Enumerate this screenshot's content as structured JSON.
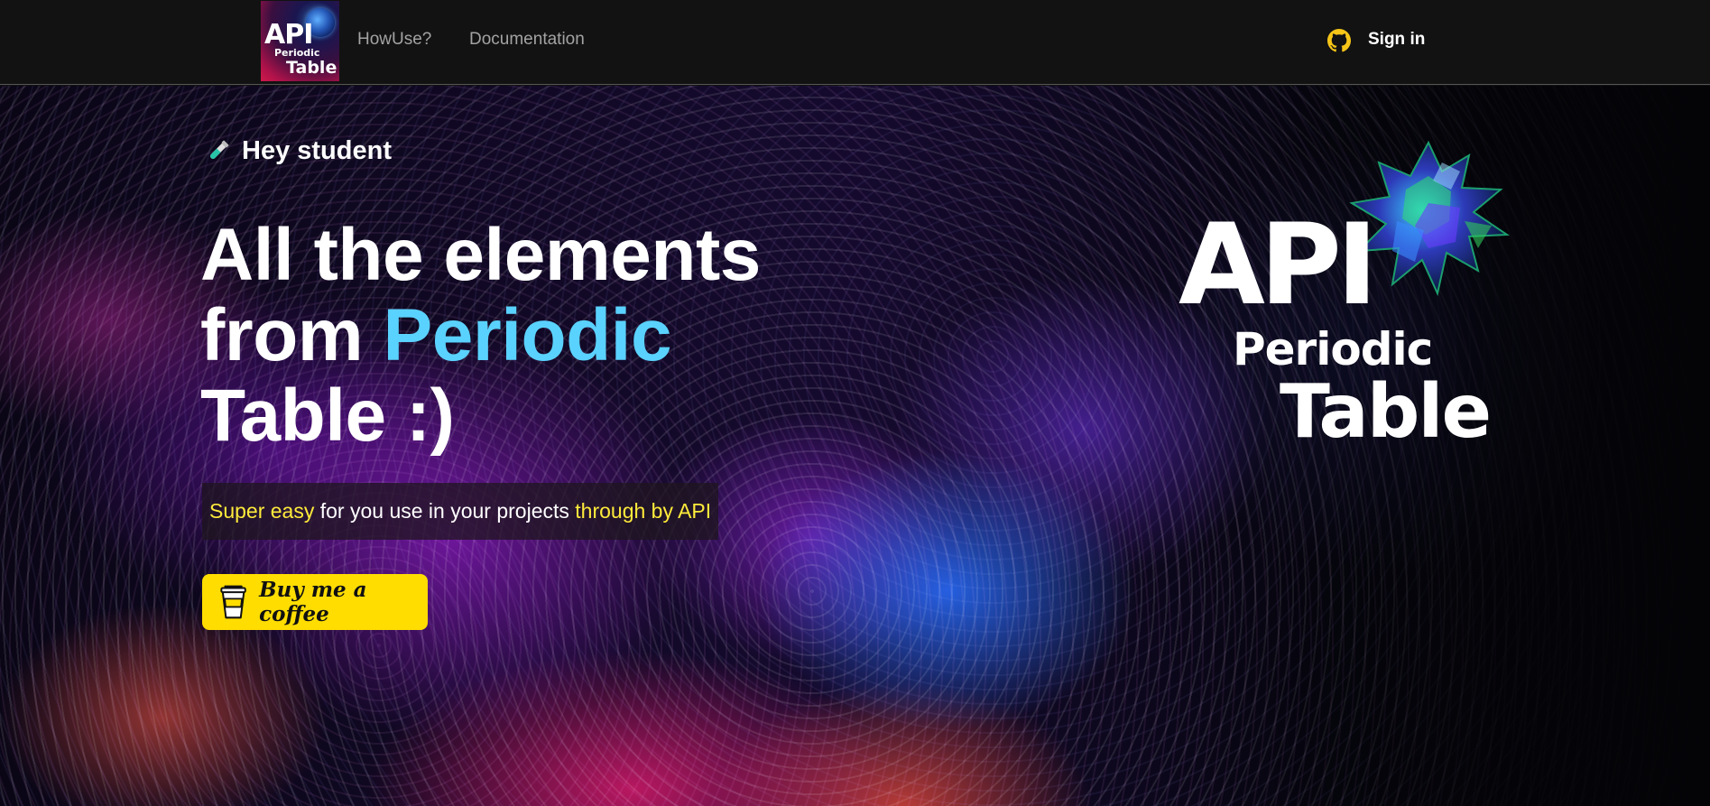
{
  "nav": {
    "logo": {
      "line1": "API",
      "line2": "Periodic",
      "line3": "Table"
    },
    "links": [
      {
        "label": "HowUse?"
      },
      {
        "label": "Documentation"
      }
    ],
    "sign_in": "Sign in",
    "github_icon": "github-icon"
  },
  "hero": {
    "greeting": "Hey student",
    "greeting_icon": "test-tube-icon",
    "headline": {
      "part1": "All the elements",
      "part2": "from",
      "accent": "Periodic",
      "part3": "Table :)"
    },
    "tagline": {
      "highlight1": "Super easy",
      "middle": " for you use in your projects ",
      "highlight2": "through by API"
    },
    "coffee_button": {
      "label": "Buy me a coffee",
      "icon": "coffee-cup-icon"
    },
    "brand": {
      "line1": "API",
      "line2": "Periodic",
      "line3": "Table"
    }
  },
  "colors": {
    "accent_blue": "#5ad2ff",
    "highlight_yellow": "#ffeb3b",
    "button_yellow": "#ffdd00",
    "github_icon": "#f5c518"
  }
}
